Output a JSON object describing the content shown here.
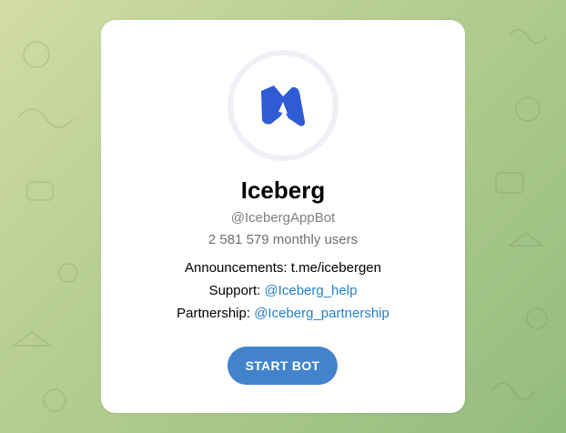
{
  "bot": {
    "name": "Iceberg",
    "username": "@IcebergAppBot",
    "monthly_users": "2 581 579 monthly users",
    "logo_icon": "iceberg-logo-icon"
  },
  "description": {
    "announcements_label": "Announcements: t.me/icebergen",
    "support_label": "Support: ",
    "support_link": "@Iceberg_help",
    "partnership_label": "Partnership: ",
    "partnership_link": "@Iceberg_partnership"
  },
  "actions": {
    "start_label": "START BOT"
  },
  "colors": {
    "accent": "#4283cc",
    "link": "#2481cc",
    "logo": "#2f5bd6"
  }
}
